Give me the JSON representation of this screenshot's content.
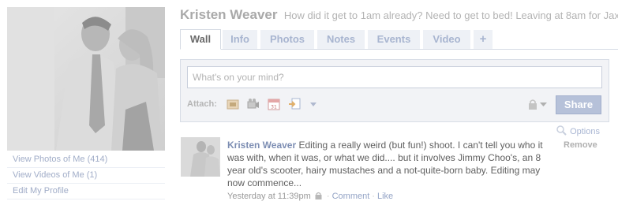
{
  "profile": {
    "name": "Kristen Weaver",
    "status": "How did it get to 1am already? Need to get to bed! Leaving at 8am for Jax!"
  },
  "left_links": [
    {
      "label": "View Photos of Me (414)"
    },
    {
      "label": "View Videos of Me (1)"
    },
    {
      "label": "Edit My Profile"
    }
  ],
  "tabs": [
    {
      "label": "Wall",
      "active": true
    },
    {
      "label": "Info"
    },
    {
      "label": "Photos"
    },
    {
      "label": "Notes"
    },
    {
      "label": "Events"
    },
    {
      "label": "Video"
    },
    {
      "label": "+"
    }
  ],
  "publisher": {
    "placeholder": "What's on your mind?",
    "attach_label": "Attach:",
    "share_label": "Share"
  },
  "options_label": "Options",
  "remove_label": "Remove",
  "story": {
    "author": "Kristen Weaver",
    "text": "Editing a really weird (but fun!) shoot. I can't tell you who it was with, when it was, or what we did.... but it involves Jimmy Choo's, an 8 year old's scooter, hairy mustaches and a not-quite-born baby. Editing may now commence...",
    "time": "Yesterday at 11:39pm",
    "comment_label": "Comment",
    "like_label": "Like"
  },
  "colors": {
    "link": "#a1adc8",
    "share_button": "#b6c1d9",
    "tab_inactive": "#a8b5d0"
  }
}
